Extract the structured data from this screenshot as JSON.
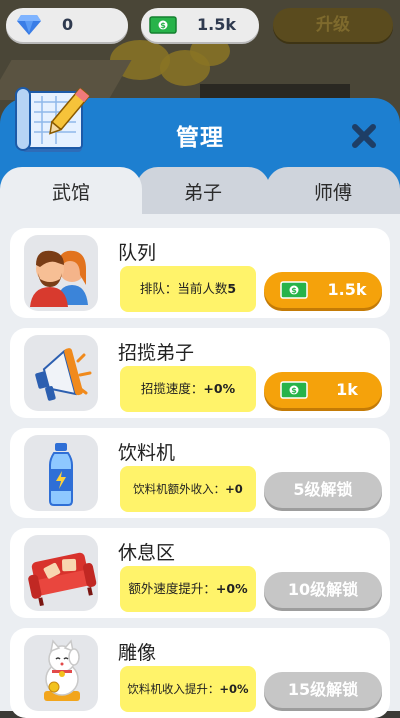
{
  "hud": {
    "gems": "0",
    "cash": "1.5k",
    "upgrade_label": "升级"
  },
  "panel": {
    "title": "管理"
  },
  "tabs": [
    {
      "label": "武馆",
      "active": true
    },
    {
      "label": "弟子",
      "active": false
    },
    {
      "label": "师傅",
      "active": false
    }
  ],
  "cards": [
    {
      "title": "队列",
      "info_label": "排队：当前人数",
      "info_value": "5",
      "button": "1.5k",
      "button_type": "buy",
      "icon": "people-icon"
    },
    {
      "title": "招揽弟子",
      "info_label": "招揽速度：",
      "info_value": "+0%",
      "button": "1k",
      "button_type": "buy",
      "icon": "megaphone-icon"
    },
    {
      "title": "饮料机",
      "info_label": "饮料机额外收入：",
      "info_value": "+0",
      "button": "5级解锁",
      "button_type": "locked",
      "icon": "water-bottle-icon"
    },
    {
      "title": "休息区",
      "info_label": "额外速度提升：",
      "info_value": "+0%",
      "button": "10级解锁",
      "button_type": "locked",
      "icon": "sofa-icon"
    },
    {
      "title": "雕像",
      "info_label": "饮料机收入提升：",
      "info_value": "+0%",
      "button": "15级解锁",
      "button_type": "locked",
      "icon": "lucky-cat-icon"
    }
  ],
  "colors": {
    "panel_blue": "#1d7fd0",
    "buy_orange": "#f5a20b",
    "info_yellow": "#fff36a",
    "locked_gray": "#c6c6c6"
  }
}
